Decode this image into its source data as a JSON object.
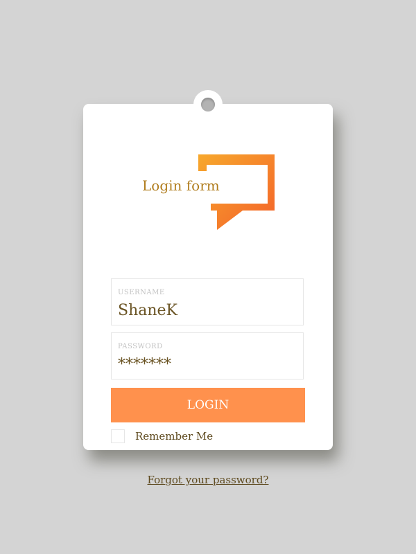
{
  "logo": {
    "text": "Login form",
    "icon": "speech-bubble-icon",
    "gradient_start": "#f7a82c",
    "gradient_end": "#f4622a"
  },
  "username": {
    "label": "USERNAME",
    "value": "ShaneK"
  },
  "password": {
    "label": "PASSWORD",
    "value": "*******"
  },
  "login_button": {
    "label": "LOGIN",
    "color": "#ff914d"
  },
  "remember": {
    "label": "Remember Me",
    "checked": false
  },
  "forgot": {
    "label": "Forgot your password?"
  },
  "colors": {
    "background": "#d4d4d4",
    "card": "#ffffff",
    "text_brown": "#5e4a1f",
    "logo_text": "#b07c1c"
  }
}
